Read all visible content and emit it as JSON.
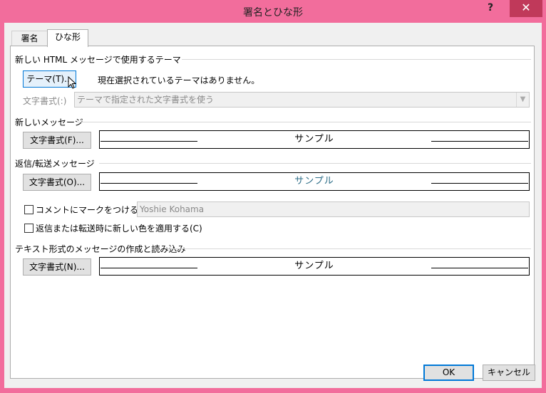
{
  "window": {
    "title": "署名とひな形",
    "help": "?",
    "close": "✕"
  },
  "tabs": [
    {
      "label": "署名"
    },
    {
      "label": "ひな形"
    }
  ],
  "theme_section": {
    "heading": "新しい HTML メッセージで使用するテーマ",
    "theme_button": "テーマ(T)...",
    "status": "現在選択されているテーマはありません。",
    "font_label": "文字書式(:)",
    "font_select": "テーマで指定された文字書式を使う"
  },
  "new_message": {
    "heading": "新しいメッセージ",
    "font_button": "文字書式(F)...",
    "sample": "サンプル"
  },
  "reply_forward": {
    "heading": "返信/転送メッセージ",
    "font_button": "文字書式(O)...",
    "sample": "サンプル",
    "mark_comments_label": "コメントにマークをつける(M):",
    "mark_comments_value": "Yoshie Kohama",
    "pick_new_color_label": "返信または転送時に新しい色を適用する(C)"
  },
  "plain_text": {
    "heading": "テキスト形式のメッセージの作成と読み込み",
    "font_button": "文字書式(N)...",
    "sample": "サンプル"
  },
  "footer": {
    "ok": "OK",
    "cancel": "キャンセル"
  }
}
